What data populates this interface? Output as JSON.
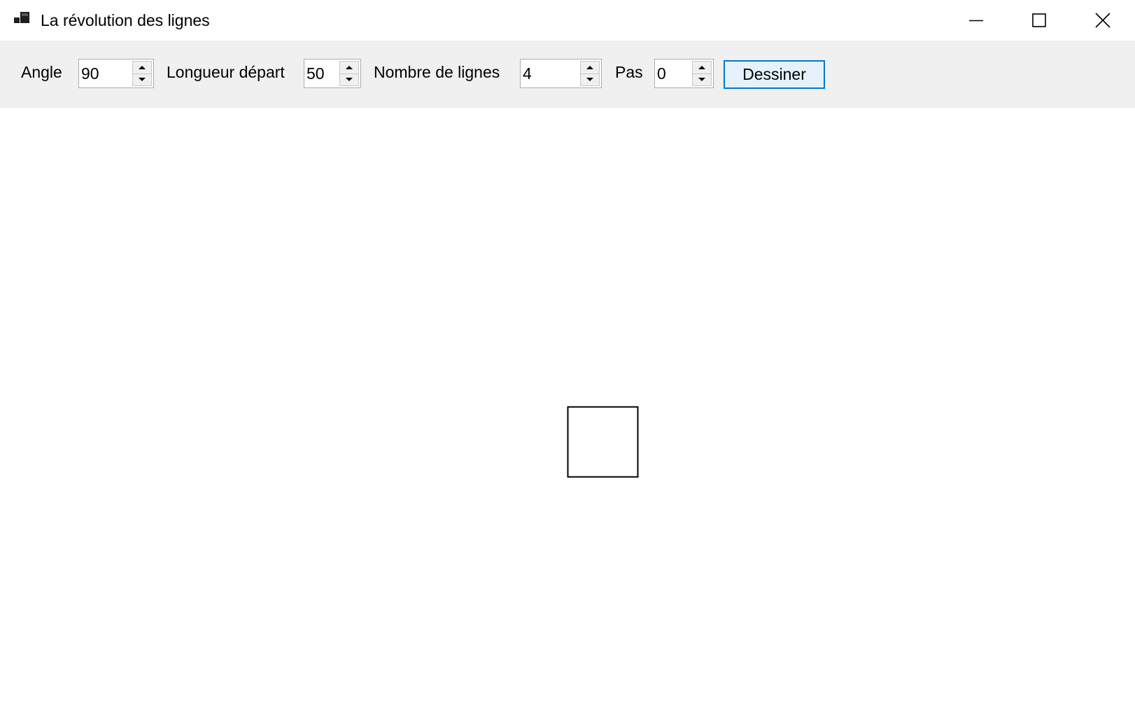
{
  "window": {
    "title": "La révolution des lignes",
    "app_icon": "app-window-icon",
    "controls": {
      "minimize_icon": "minimize-icon",
      "maximize_icon": "maximize-icon",
      "close_icon": "close-icon"
    }
  },
  "toolbar": {
    "angle": {
      "label": "Angle",
      "value": "90"
    },
    "start_length": {
      "label": "Longueur départ",
      "value": "50"
    },
    "line_count": {
      "label": "Nombre de lignes",
      "value": "4"
    },
    "step": {
      "label": "Pas",
      "value": "0"
    },
    "draw_button_label": "Dessiner"
  },
  "drawing": {
    "shape": "square",
    "stroke_color": "#000000"
  },
  "colors": {
    "toolbar_bg": "#f0f0f0",
    "canvas_bg": "#ffffff",
    "button_accent": "#0078d7",
    "button_bg": "#e5f1fb"
  }
}
